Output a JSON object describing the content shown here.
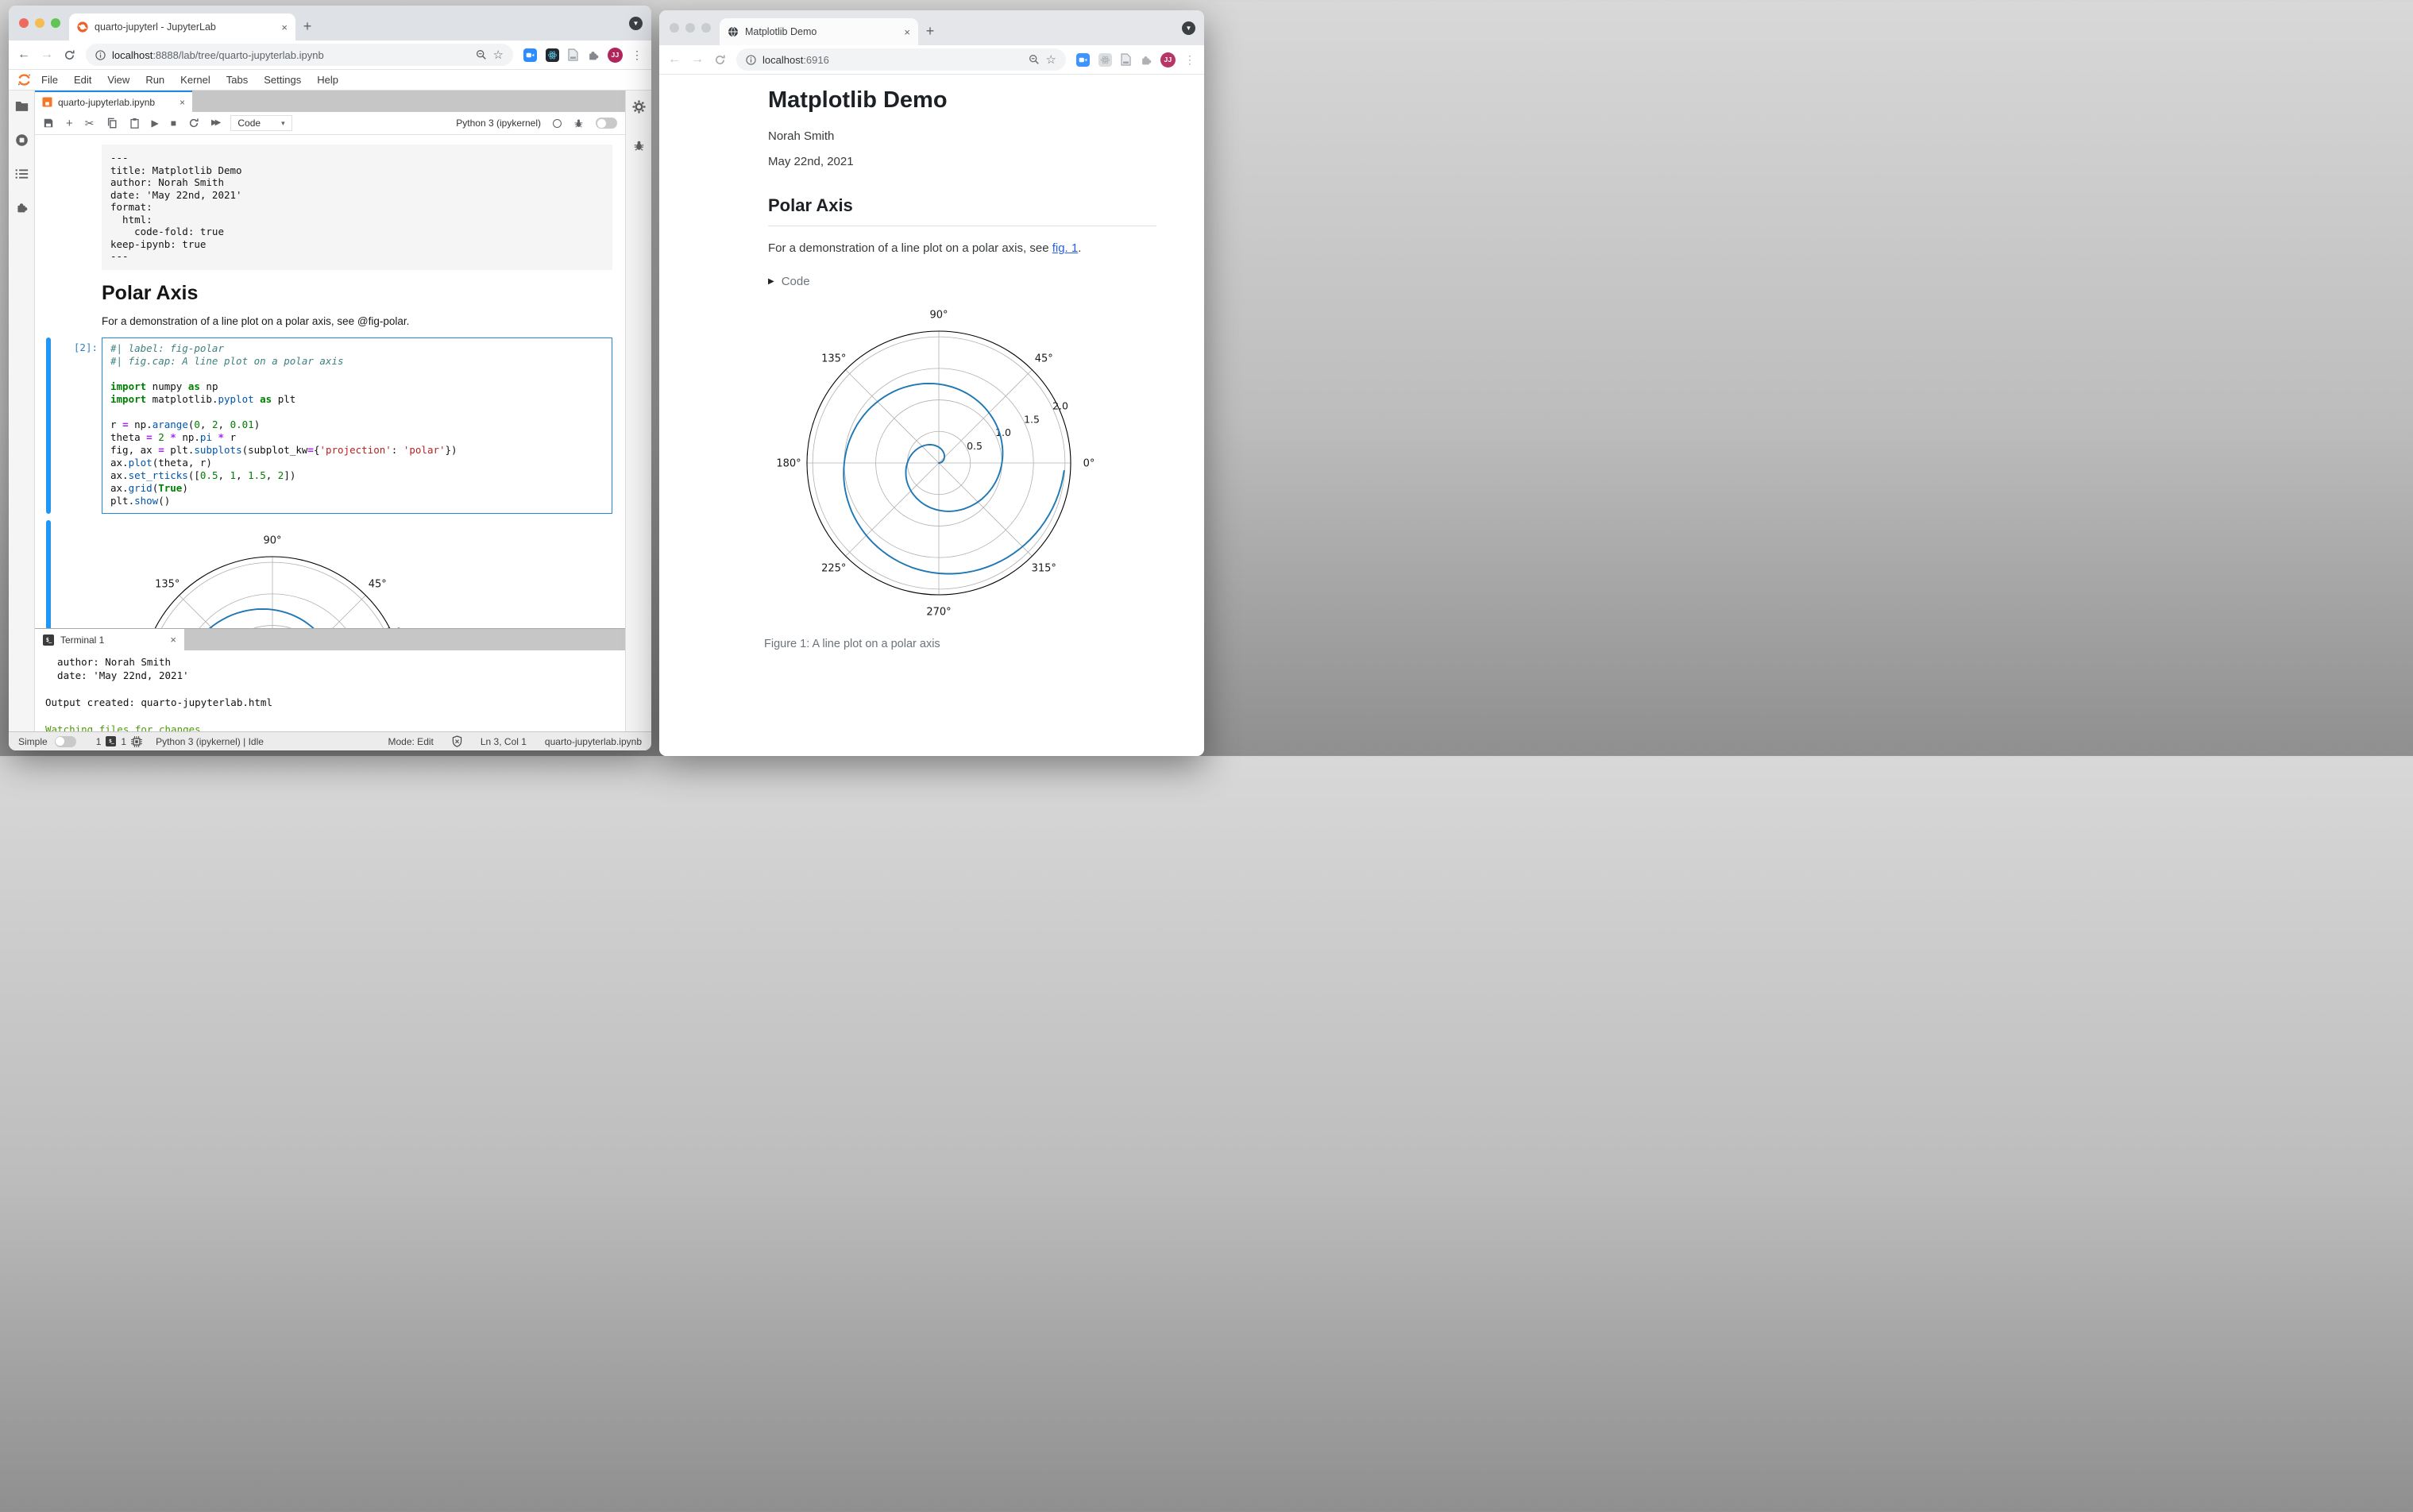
{
  "colors": {
    "accent_blue": "#1e88e5",
    "spiral_blue": "#1f77b4",
    "link_blue": "#2761e3",
    "terminal_green": "#4e9a06",
    "avatar_crimson": "#b0255c",
    "jupyter_orange": "#f37726"
  },
  "left_window": {
    "browser": {
      "tab_title": "quarto-jupyterl - JupyterLab",
      "url_host": "localhost",
      "url_rest": ":8888/lab/tree/quarto-jupyterlab.ipynb",
      "profile_initials": "JJ",
      "toolbar_icons": [
        "back-icon",
        "forward-icon",
        "reload-icon",
        "info-icon",
        "zoom-indicator-icon",
        "bookmark-star-icon"
      ],
      "extension_icons": [
        "zoom-meeting-icon",
        "react-devtools-icon",
        "document-extension-icon",
        "extensions-puzzle-icon"
      ]
    },
    "menu_items": [
      "File",
      "Edit",
      "View",
      "Run",
      "Kernel",
      "Tabs",
      "Settings",
      "Help"
    ],
    "left_sidebar_icons": [
      "folder-icon",
      "running-sessions-icon",
      "table-of-contents-icon",
      "extensions-icon"
    ],
    "right_sidebar_icons": [
      "property-inspector-gear-icon",
      "debugger-bug-icon"
    ],
    "notebook": {
      "tab_label": "quarto-jupyterlab.ipynb",
      "toolbar_icons": [
        "save-icon",
        "add-cell-icon",
        "cut-cell-icon",
        "copy-cell-icon",
        "paste-cell-icon",
        "run-icon",
        "stop-icon",
        "restart-kernel-icon",
        "run-all-icon"
      ],
      "toolbar_cell_type": "Code",
      "toolbar_kernel": "Python 3 (ipykernel)",
      "yaml_cell_lines": [
        "---",
        "title: Matplotlib Demo",
        "author: Norah Smith",
        "date: 'May 22nd, 2021'",
        "format:",
        "  html:",
        "    code-fold: true",
        "keep-ipynb: true",
        "---"
      ],
      "markdown_heading": "Polar Axis",
      "markdown_paragraph": "For a demonstration of a line plot on a polar axis, see @fig-polar.",
      "code_prompt": "[2]:",
      "code_lines": [
        [
          [
            "c",
            "#| label: fig-polar"
          ]
        ],
        [
          [
            "c",
            "#| fig.cap: A line plot on a polar axis"
          ]
        ],
        [],
        [
          [
            "k",
            "import"
          ],
          [
            "t",
            " numpy "
          ],
          [
            "k",
            "as"
          ],
          [
            "t",
            " np"
          ]
        ],
        [
          [
            "k",
            "import"
          ],
          [
            "t",
            " matplotlib."
          ],
          [
            "p",
            "pyplot"
          ],
          [
            "t",
            " "
          ],
          [
            "k",
            "as"
          ],
          [
            "t",
            " plt"
          ]
        ],
        [],
        [
          [
            "t",
            "r "
          ],
          [
            "o",
            "="
          ],
          [
            "t",
            " np."
          ],
          [
            "p",
            "arange"
          ],
          [
            "t",
            "("
          ],
          [
            "n",
            "0"
          ],
          [
            "t",
            ", "
          ],
          [
            "n",
            "2"
          ],
          [
            "t",
            ", "
          ],
          [
            "n",
            "0.01"
          ],
          [
            "t",
            ")"
          ]
        ],
        [
          [
            "t",
            "theta "
          ],
          [
            "o",
            "="
          ],
          [
            "t",
            " "
          ],
          [
            "n",
            "2"
          ],
          [
            "t",
            " "
          ],
          [
            "o",
            "*"
          ],
          [
            "t",
            " np."
          ],
          [
            "p",
            "pi"
          ],
          [
            "t",
            " "
          ],
          [
            "o",
            "*"
          ],
          [
            "t",
            " r"
          ]
        ],
        [
          [
            "t",
            "fig, ax "
          ],
          [
            "o",
            "="
          ],
          [
            "t",
            " plt."
          ],
          [
            "p",
            "subplots"
          ],
          [
            "t",
            "(subplot_kw"
          ],
          [
            "o",
            "="
          ],
          [
            "t",
            "{"
          ],
          [
            "s",
            "'projection'"
          ],
          [
            "t",
            ": "
          ],
          [
            "s",
            "'polar'"
          ],
          [
            "t",
            "})"
          ]
        ],
        [
          [
            "t",
            "ax."
          ],
          [
            "p",
            "plot"
          ],
          [
            "t",
            "(theta, r)"
          ]
        ],
        [
          [
            "t",
            "ax."
          ],
          [
            "p",
            "set_rticks"
          ],
          [
            "t",
            "(["
          ],
          [
            "n",
            "0.5"
          ],
          [
            "t",
            ", "
          ],
          [
            "n",
            "1"
          ],
          [
            "t",
            ", "
          ],
          [
            "n",
            "1.5"
          ],
          [
            "t",
            ", "
          ],
          [
            "n",
            "2"
          ],
          [
            "t",
            "])"
          ]
        ],
        [
          [
            "t",
            "ax."
          ],
          [
            "p",
            "grid"
          ],
          [
            "t",
            "("
          ],
          [
            "k",
            "True"
          ],
          [
            "t",
            ")"
          ]
        ],
        [
          [
            "t",
            "plt."
          ],
          [
            "p",
            "show"
          ],
          [
            "t",
            "()"
          ]
        ]
      ]
    },
    "terminal": {
      "tab_label": "Terminal 1",
      "lines": [
        {
          "text": "  author: Norah Smith",
          "cls": ""
        },
        {
          "text": "  date: 'May 22nd, 2021'",
          "cls": ""
        },
        {
          "text": "",
          "cls": ""
        },
        {
          "text": "Output created: quarto-jupyterlab.html",
          "cls": ""
        },
        {
          "text": "",
          "cls": ""
        },
        {
          "text": "Watching files for changes",
          "cls": "term-green"
        }
      ]
    },
    "statusbar": {
      "simple_label": "Simple",
      "terminal_count": "1",
      "kernel_count": "1",
      "kernel_status": "Python 3 (ipykernel) | Idle",
      "mode": "Mode: Edit",
      "cursor_position": "Ln 3, Col 1",
      "filename": "quarto-jupyterlab.ipynb"
    }
  },
  "right_window": {
    "browser": {
      "tab_title": "Matplotlib Demo",
      "url_host": "localhost",
      "url_rest": ":6916",
      "profile_initials": "JJ"
    },
    "document": {
      "title": "Matplotlib Demo",
      "author": "Norah Smith",
      "date": "May 22nd, 2021",
      "section_heading": "Polar Axis",
      "paragraph_prefix": "For a demonstration of a line plot on a polar axis, see ",
      "link_text": "fig. 1",
      "paragraph_suffix": ".",
      "code_fold_label": "Code",
      "figure_caption": "Figure 1: A line plot on a polar axis"
    }
  },
  "chart_data": {
    "type": "line",
    "projection": "polar",
    "series": [
      {
        "name": "spiral",
        "r_start": 0,
        "r_end": 2,
        "r_step": 0.01,
        "theta_formula": "theta = 2 * pi * r"
      }
    ],
    "theta_ticks_deg": [
      0,
      45,
      90,
      135,
      180,
      225,
      270,
      315
    ],
    "theta_tick_labels": [
      "0°",
      "45°",
      "90°",
      "135°",
      "180°",
      "225°",
      "270°",
      "315°"
    ],
    "r_ticks": [
      0.5,
      1.0,
      1.5,
      2.0
    ],
    "r_tick_labels": [
      "0.5",
      "1.0",
      "1.5",
      "2.0"
    ],
    "r_max_display": 2.09,
    "r_label_angle_deg": 25,
    "grid": true,
    "line_color": "#1f77b4",
    "caption": "Figure 1: A line plot on a polar axis"
  }
}
